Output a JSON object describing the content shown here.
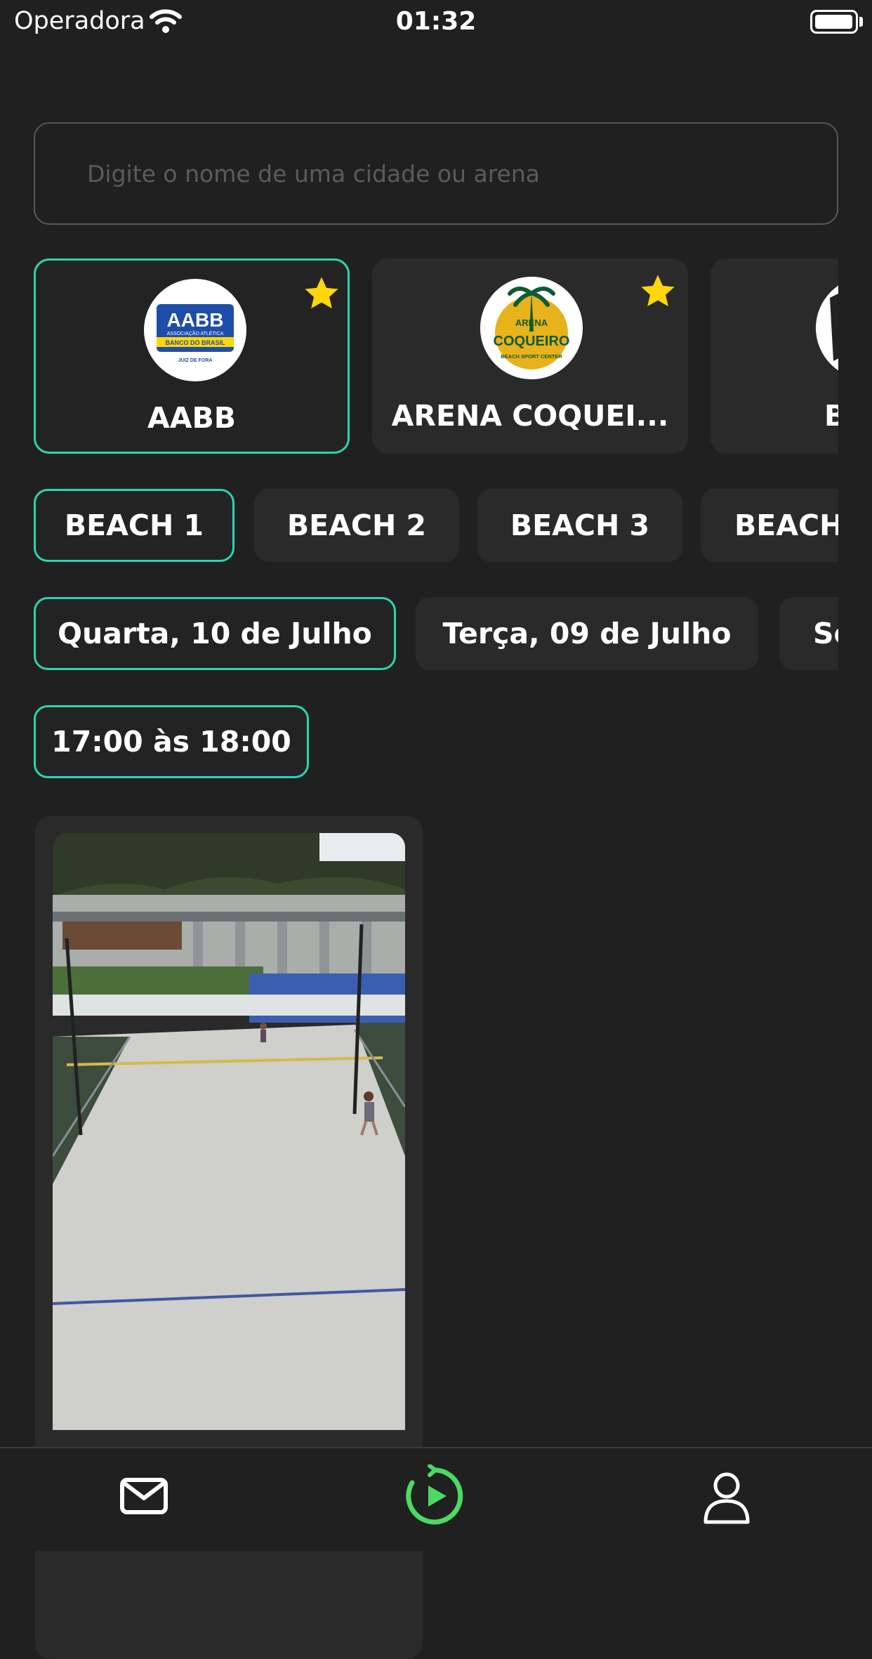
{
  "status_bar": {
    "carrier": "Operadora",
    "time": "01:32"
  },
  "search": {
    "placeholder": "Digite o nome de uma cidade ou arena",
    "value": ""
  },
  "arenas": [
    {
      "name": "AABB",
      "favorite": true,
      "selected": true,
      "logo": "aabb-logo"
    },
    {
      "name": "ARENA COQUEI...",
      "favorite": true,
      "selected": false,
      "logo": "arena-coqueiro-logo"
    },
    {
      "name": "BO",
      "favorite": false,
      "selected": false,
      "logo": "arena-logo"
    }
  ],
  "arena_logos": {
    "aabb": {
      "main": "AABB",
      "sub1": "ASSOCIAÇÃO ATLÉTICA",
      "sub2": "BANCO DO BRASIL",
      "sub3": "JUIZ DE FORA"
    },
    "coqueiro": {
      "top": "ARENA",
      "main": "COQUEIRO",
      "sub": "BEACH SPORT CENTER"
    }
  },
  "courts": [
    {
      "label": "BEACH 1",
      "selected": true
    },
    {
      "label": "BEACH 2",
      "selected": false
    },
    {
      "label": "BEACH 3",
      "selected": false
    },
    {
      "label": "BEACH",
      "selected": false
    }
  ],
  "dates": [
    {
      "label": "Quarta, 10 de Julho",
      "selected": true
    },
    {
      "label": "Terça, 09 de Julho",
      "selected": false
    },
    {
      "label": "Se",
      "selected": false
    }
  ],
  "times": [
    {
      "label": "17:00 às 18:00",
      "selected": true
    }
  ],
  "colors": {
    "accent": "#2cd3b3",
    "accent2": "#4cd964",
    "star": "#ffd60a",
    "background": "#202020",
    "card": "#2a2a2a"
  },
  "tabbar": {
    "icons": [
      "mail-icon",
      "replay-timer-icon",
      "profile-icon"
    ]
  }
}
